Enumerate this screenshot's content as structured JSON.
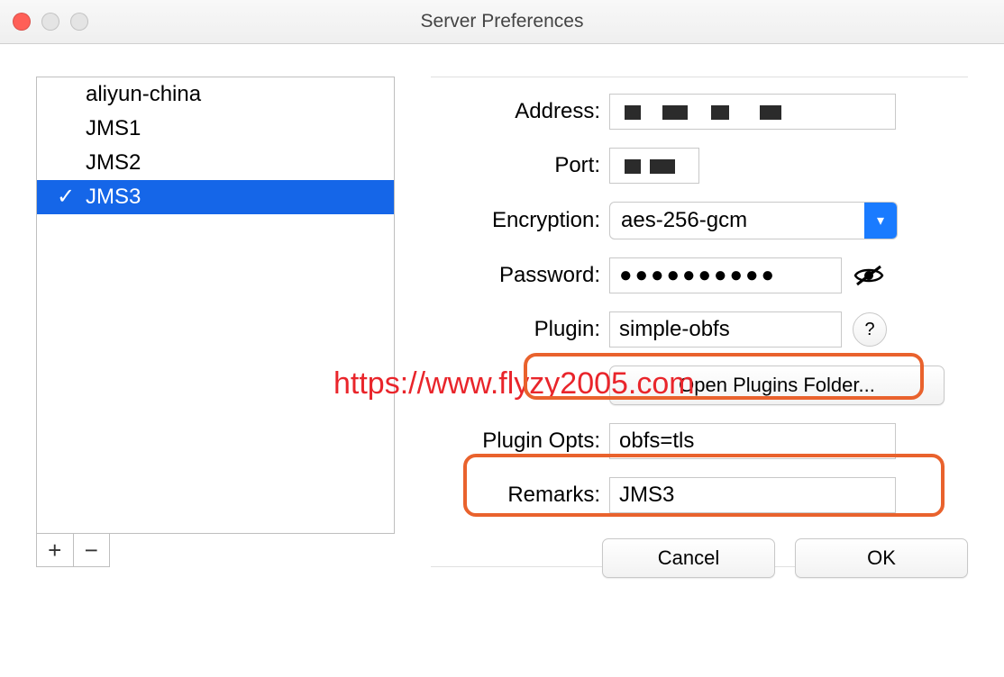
{
  "window": {
    "title": "Server Preferences"
  },
  "servers": {
    "items": [
      {
        "name": "aliyun-china",
        "active": false,
        "selected": false
      },
      {
        "name": "JMS1",
        "active": false,
        "selected": false
      },
      {
        "name": "JMS2",
        "active": false,
        "selected": false
      },
      {
        "name": "JMS3",
        "active": true,
        "selected": true
      }
    ]
  },
  "form": {
    "labels": {
      "address": "Address:",
      "port": "Port:",
      "encryption": "Encryption:",
      "password": "Password:",
      "plugin": "Plugin:",
      "plugin_opts": "Plugin Opts:",
      "remarks": "Remarks:"
    },
    "values": {
      "address": "",
      "port": "",
      "encryption": "aes-256-gcm",
      "password": "●●●●●●●●●●",
      "plugin": "simple-obfs",
      "plugin_opts": "obfs=tls",
      "remarks": "JMS3"
    },
    "buttons": {
      "open_plugins": "Open Plugins Folder...",
      "help": "?",
      "cancel": "Cancel",
      "ok": "OK"
    }
  },
  "icons": {
    "checkmark": "✓",
    "plus": "+",
    "minus": "−",
    "chevron_down": "▾"
  },
  "watermark": "https://www.flyzy2005.com"
}
